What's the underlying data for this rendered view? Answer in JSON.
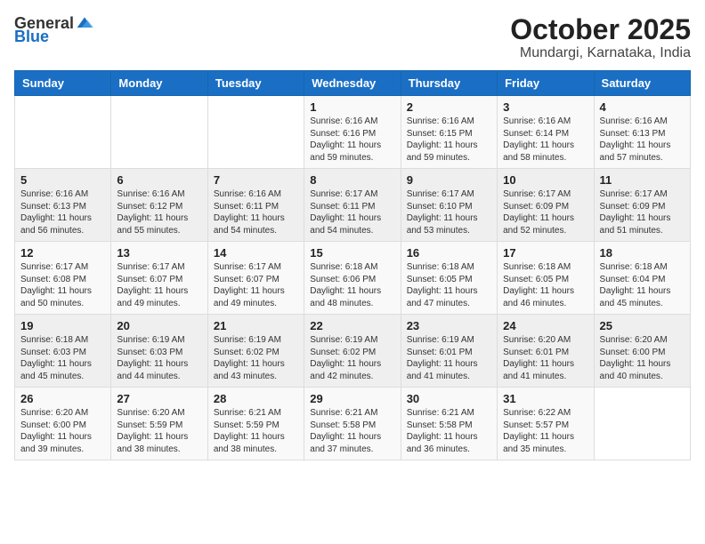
{
  "header": {
    "logo_general": "General",
    "logo_blue": "Blue",
    "title": "October 2025",
    "subtitle": "Mundargi, Karnataka, India"
  },
  "weekdays": [
    "Sunday",
    "Monday",
    "Tuesday",
    "Wednesday",
    "Thursday",
    "Friday",
    "Saturday"
  ],
  "weeks": [
    [
      {
        "day": "",
        "info": ""
      },
      {
        "day": "",
        "info": ""
      },
      {
        "day": "",
        "info": ""
      },
      {
        "day": "1",
        "info": "Sunrise: 6:16 AM\nSunset: 6:16 PM\nDaylight: 11 hours and 59 minutes."
      },
      {
        "day": "2",
        "info": "Sunrise: 6:16 AM\nSunset: 6:15 PM\nDaylight: 11 hours and 59 minutes."
      },
      {
        "day": "3",
        "info": "Sunrise: 6:16 AM\nSunset: 6:14 PM\nDaylight: 11 hours and 58 minutes."
      },
      {
        "day": "4",
        "info": "Sunrise: 6:16 AM\nSunset: 6:13 PM\nDaylight: 11 hours and 57 minutes."
      }
    ],
    [
      {
        "day": "5",
        "info": "Sunrise: 6:16 AM\nSunset: 6:13 PM\nDaylight: 11 hours and 56 minutes."
      },
      {
        "day": "6",
        "info": "Sunrise: 6:16 AM\nSunset: 6:12 PM\nDaylight: 11 hours and 55 minutes."
      },
      {
        "day": "7",
        "info": "Sunrise: 6:16 AM\nSunset: 6:11 PM\nDaylight: 11 hours and 54 minutes."
      },
      {
        "day": "8",
        "info": "Sunrise: 6:17 AM\nSunset: 6:11 PM\nDaylight: 11 hours and 54 minutes."
      },
      {
        "day": "9",
        "info": "Sunrise: 6:17 AM\nSunset: 6:10 PM\nDaylight: 11 hours and 53 minutes."
      },
      {
        "day": "10",
        "info": "Sunrise: 6:17 AM\nSunset: 6:09 PM\nDaylight: 11 hours and 52 minutes."
      },
      {
        "day": "11",
        "info": "Sunrise: 6:17 AM\nSunset: 6:09 PM\nDaylight: 11 hours and 51 minutes."
      }
    ],
    [
      {
        "day": "12",
        "info": "Sunrise: 6:17 AM\nSunset: 6:08 PM\nDaylight: 11 hours and 50 minutes."
      },
      {
        "day": "13",
        "info": "Sunrise: 6:17 AM\nSunset: 6:07 PM\nDaylight: 11 hours and 49 minutes."
      },
      {
        "day": "14",
        "info": "Sunrise: 6:17 AM\nSunset: 6:07 PM\nDaylight: 11 hours and 49 minutes."
      },
      {
        "day": "15",
        "info": "Sunrise: 6:18 AM\nSunset: 6:06 PM\nDaylight: 11 hours and 48 minutes."
      },
      {
        "day": "16",
        "info": "Sunrise: 6:18 AM\nSunset: 6:05 PM\nDaylight: 11 hours and 47 minutes."
      },
      {
        "day": "17",
        "info": "Sunrise: 6:18 AM\nSunset: 6:05 PM\nDaylight: 11 hours and 46 minutes."
      },
      {
        "day": "18",
        "info": "Sunrise: 6:18 AM\nSunset: 6:04 PM\nDaylight: 11 hours and 45 minutes."
      }
    ],
    [
      {
        "day": "19",
        "info": "Sunrise: 6:18 AM\nSunset: 6:03 PM\nDaylight: 11 hours and 45 minutes."
      },
      {
        "day": "20",
        "info": "Sunrise: 6:19 AM\nSunset: 6:03 PM\nDaylight: 11 hours and 44 minutes."
      },
      {
        "day": "21",
        "info": "Sunrise: 6:19 AM\nSunset: 6:02 PM\nDaylight: 11 hours and 43 minutes."
      },
      {
        "day": "22",
        "info": "Sunrise: 6:19 AM\nSunset: 6:02 PM\nDaylight: 11 hours and 42 minutes."
      },
      {
        "day": "23",
        "info": "Sunrise: 6:19 AM\nSunset: 6:01 PM\nDaylight: 11 hours and 41 minutes."
      },
      {
        "day": "24",
        "info": "Sunrise: 6:20 AM\nSunset: 6:01 PM\nDaylight: 11 hours and 41 minutes."
      },
      {
        "day": "25",
        "info": "Sunrise: 6:20 AM\nSunset: 6:00 PM\nDaylight: 11 hours and 40 minutes."
      }
    ],
    [
      {
        "day": "26",
        "info": "Sunrise: 6:20 AM\nSunset: 6:00 PM\nDaylight: 11 hours and 39 minutes."
      },
      {
        "day": "27",
        "info": "Sunrise: 6:20 AM\nSunset: 5:59 PM\nDaylight: 11 hours and 38 minutes."
      },
      {
        "day": "28",
        "info": "Sunrise: 6:21 AM\nSunset: 5:59 PM\nDaylight: 11 hours and 38 minutes."
      },
      {
        "day": "29",
        "info": "Sunrise: 6:21 AM\nSunset: 5:58 PM\nDaylight: 11 hours and 37 minutes."
      },
      {
        "day": "30",
        "info": "Sunrise: 6:21 AM\nSunset: 5:58 PM\nDaylight: 11 hours and 36 minutes."
      },
      {
        "day": "31",
        "info": "Sunrise: 6:22 AM\nSunset: 5:57 PM\nDaylight: 11 hours and 35 minutes."
      },
      {
        "day": "",
        "info": ""
      }
    ]
  ]
}
